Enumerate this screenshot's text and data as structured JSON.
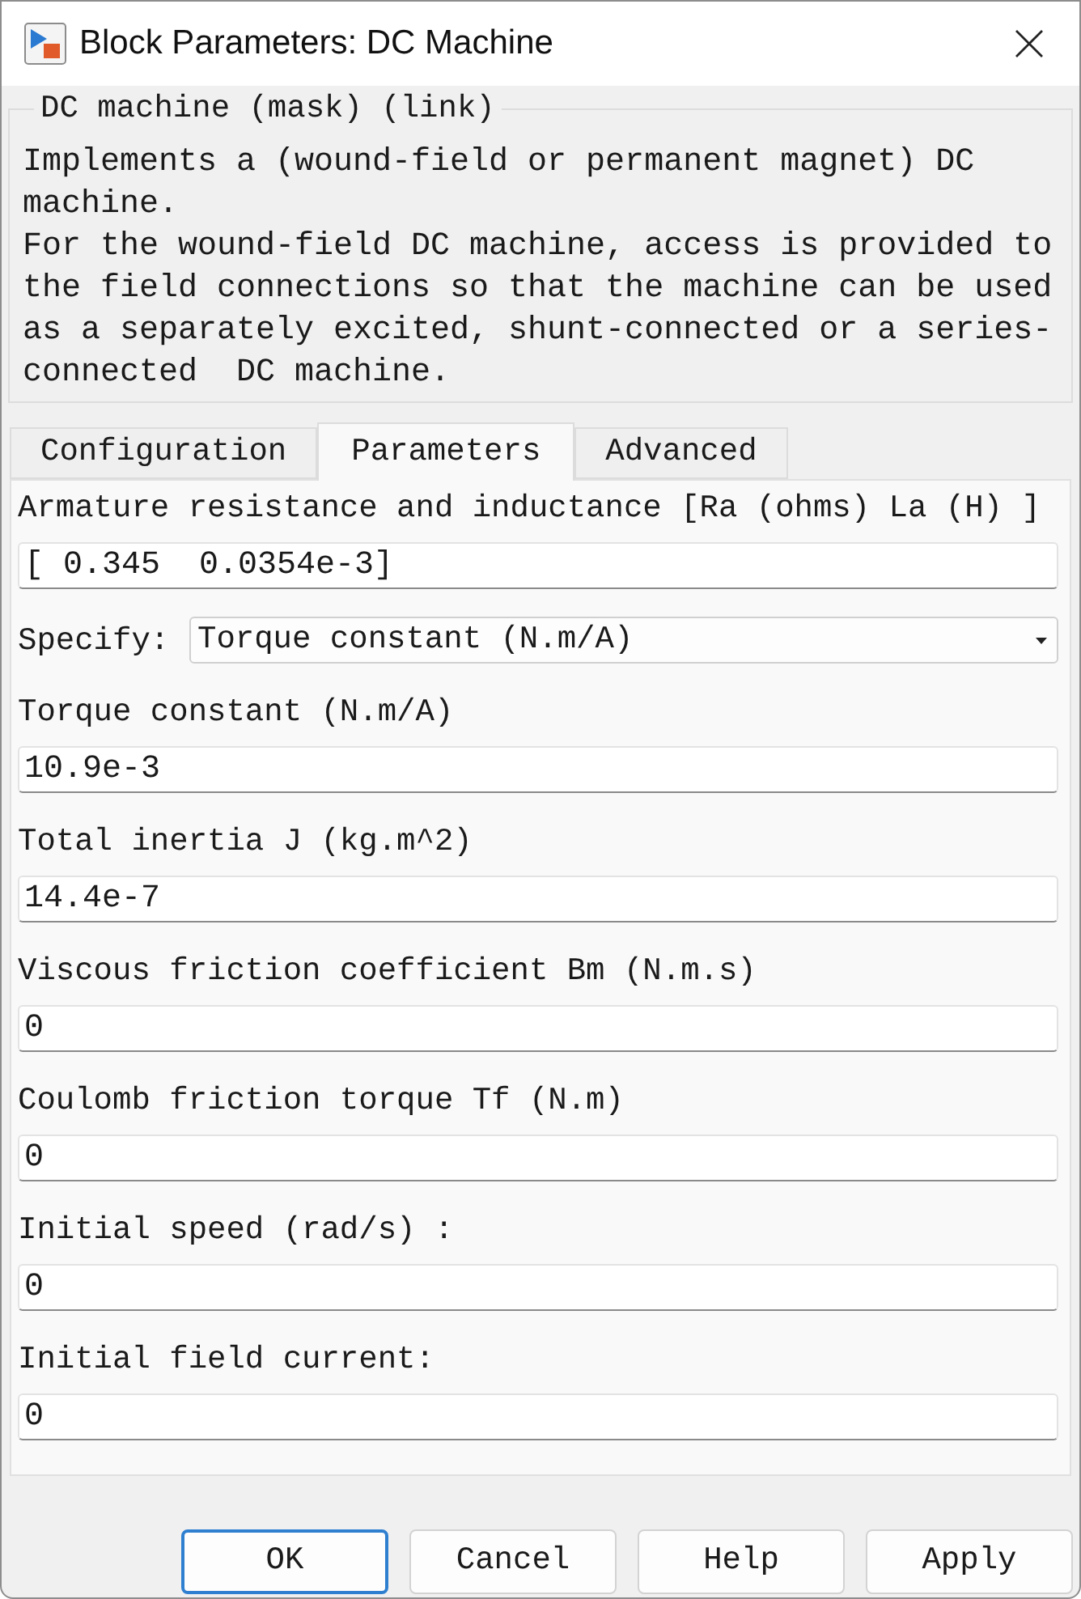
{
  "window": {
    "title": "Block Parameters: DC Machine"
  },
  "mask_group": {
    "title": "DC machine (mask) (link)",
    "description": [
      "Implements a (wound-field or permanent magnet) DC machine.",
      "For the wound-field DC machine, access is provided to the field connections so that the machine can be used as a separately excited, shunt-connected or a series-connected  DC machine."
    ]
  },
  "tabs": [
    {
      "label": "Configuration",
      "selected": false
    },
    {
      "label": "Parameters",
      "selected": true
    },
    {
      "label": "Advanced",
      "selected": false
    }
  ],
  "parameters": [
    {
      "kind": "text",
      "label": "Armature resistance and inductance [Ra (ohms) La (H) ]",
      "value": "[ 0.345  0.0354e-3]"
    },
    {
      "kind": "dropdown",
      "label": "Specify:",
      "value": "Torque constant (N.m/A)"
    },
    {
      "kind": "text",
      "label": "Torque constant (N.m/A)",
      "value": "10.9e-3"
    },
    {
      "kind": "text",
      "label": "Total inertia J (kg.m^2)",
      "value": "14.4e-7"
    },
    {
      "kind": "text",
      "label": "Viscous friction coefficient Bm (N.m.s)",
      "value": "0"
    },
    {
      "kind": "text",
      "label": "Coulomb friction torque Tf (N.m)",
      "value": "0"
    },
    {
      "kind": "text",
      "label": "Initial speed (rad/s) :",
      "value": "0"
    },
    {
      "kind": "text",
      "label": "Initial field current:",
      "value": "0"
    }
  ],
  "buttons": [
    {
      "label": "OK",
      "focused": true
    },
    {
      "label": "Cancel",
      "focused": false
    },
    {
      "label": "Help",
      "focused": false
    },
    {
      "label": "Apply",
      "focused": false
    }
  ]
}
